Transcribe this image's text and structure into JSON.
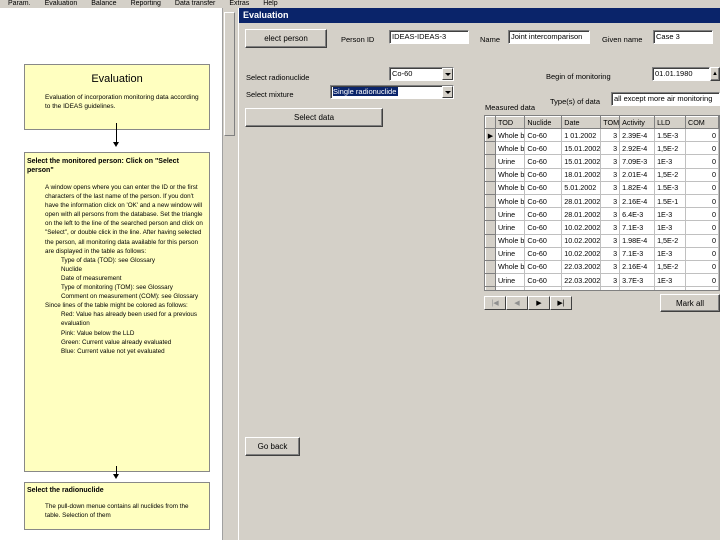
{
  "menu": [
    "Param.",
    "Evaluation",
    "Balance",
    "Reporting",
    "Data transfer",
    "Extras",
    "Help"
  ],
  "help": {
    "box1_title": "Evaluation",
    "box1_text": "Evaluation of incorporation monitoring data according to the IDEAS guidelines.",
    "box2_title": "Select the monitored person: Click on \"Select person\"",
    "box2_paragraphs": [
      "A window opens where you can enter the ID or the first characters of the last name of the person. If you don't have the information click on 'OK' and a new window will open with all persons from the database. Set the triangle on the left to the line of the searched person and click on \"Select\", or double click in the line. After having selected the person, all monitoring data available for this person are displayed in the table as follows:"
    ],
    "box2_list": [
      "Type of data (TOD): see Glossary",
      "Nuclide",
      "Date of measurement",
      "Type of monitoring (TOM): see Glossary",
      "Comment on measurement (COM): see Glossary"
    ],
    "box2_colors_intro": "Since lines of the table might be colored as follows:",
    "box2_colors": [
      "Red: Value has already been used for a previous evaluation",
      "Pink: Value below the LLD",
      "Green: Current value already evaluated",
      "Blue: Current value not yet evaluated"
    ],
    "box3_title": "Select the radionuclide",
    "box3_text": "The pull-down menue contains all nuclides from the table. Selection of them"
  },
  "window": {
    "title": "Evaluation",
    "select_person_label": "elect person",
    "person_id_label": "Person ID",
    "person_id_value": "IDEAS-IDEAS-3",
    "name_label": "Name",
    "name_value": "Joint intercomparison",
    "given_name_label": "Given name",
    "given_name_value": "Case 3",
    "select_radionuclide_label": "Select radionuclide",
    "select_radionuclide_value": "Co-60",
    "select_mixture_label": "Select mixture",
    "select_mixture_value": "Single radionuclide",
    "select_data_label": "Select data",
    "begin_monitoring_label": "Begin of monitoring",
    "begin_monitoring_value": "01.01.1980",
    "type_of_data_label": "Type(s) of data",
    "type_of_data_value": "all except more air monitoring",
    "measured_data_label": "Measured data",
    "mark_all_label": "Mark all",
    "go_back_label": "Go back"
  },
  "grid": {
    "columns": [
      "TOD",
      "Nuclide",
      "Date",
      "TOM",
      "Activity",
      "LLD",
      "COM"
    ],
    "rows": [
      [
        "Whole b",
        "Co-60",
        "1 01.2002",
        "3",
        "2.39E-4",
        "1.5E-3",
        "0"
      ],
      [
        "Whole b",
        "Co-60",
        "15.01.2002",
        "3",
        "2.92E-4",
        "1,5E-2",
        "0"
      ],
      [
        "Urine",
        "Co-60",
        "15.01.2002",
        "3",
        "7.09E-3",
        "1E-3",
        "0"
      ],
      [
        "Whole b",
        "Co-60",
        "18.01.2002",
        "3",
        "2.01E-4",
        "1,5E-2",
        "0"
      ],
      [
        "Whole b",
        "Co-60",
        "5.01.2002",
        "3",
        "1.82E-4",
        "1.5E-3",
        "0"
      ],
      [
        "Whole b",
        "Co-60",
        "28.01.2002",
        "3",
        "2.16E-4",
        "1.5E-1",
        "0"
      ],
      [
        "Urine",
        "Co-60",
        "28.01.2002",
        "3",
        "6.4E-3",
        "1E-3",
        "0"
      ],
      [
        "Urine",
        "Co-60",
        "10.02.2002",
        "3",
        "7.1E-3",
        "1E-3",
        "0"
      ],
      [
        "Whole b",
        "Co-60",
        "10.02.2002",
        "3",
        "1.98E-4",
        "1,5E-2",
        "0"
      ],
      [
        "Urine",
        "Co-60",
        "10.02.2002",
        "3",
        "7.1E-3",
        "1E-3",
        "0"
      ],
      [
        "Whole b",
        "Co-60",
        "22.03.2002",
        "3",
        "2.16E-4",
        "1,5E-2",
        "0"
      ],
      [
        "Urine",
        "Co-60",
        "22.03.2002",
        "3",
        "3.7E-3",
        "1E-3",
        "0"
      ],
      [
        "Whole b",
        "Co-60",
        "22.03.2002",
        "3",
        "1.75E-4",
        "1,5E-2",
        "0"
      ]
    ]
  },
  "nav": [
    "|◀",
    "◀",
    "▶",
    "▶|"
  ],
  "colors": {
    "titlebar": "#0a246a",
    "help_box": "#ffffc0"
  }
}
